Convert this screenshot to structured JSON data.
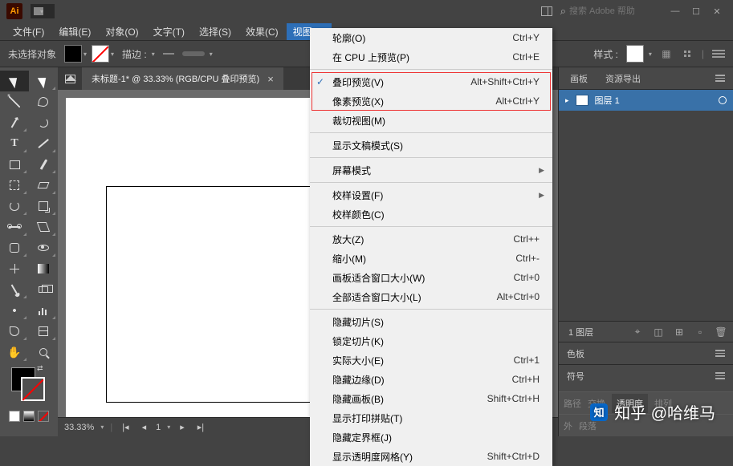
{
  "titlebar": {
    "app_badge": "Ai",
    "search_placeholder": "搜索 Adobe 帮助"
  },
  "menubar": {
    "items": [
      "文件(F)",
      "编辑(E)",
      "对象(O)",
      "文字(T)",
      "选择(S)",
      "效果(C)",
      "视图(V)"
    ],
    "active_index": 6
  },
  "options_bar": {
    "no_selection": "未选择对象",
    "stroke_label": "描边 :",
    "style_label": "样式 :"
  },
  "doc": {
    "tab_title": "未标题-1* @ 33.33% (RGB/CPU 叠印预览)",
    "zoom": "33.33%",
    "artboard_nav": "1"
  },
  "dropdown": {
    "items": [
      {
        "label": "轮廓(O)",
        "short": "Ctrl+Y"
      },
      {
        "label": "在 CPU 上预览(P)",
        "short": "Ctrl+E"
      },
      {
        "sep": true
      },
      {
        "label": "叠印预览(V)",
        "short": "Alt+Shift+Ctrl+Y",
        "checked": true,
        "hl": true
      },
      {
        "label": "像素预览(X)",
        "short": "Alt+Ctrl+Y",
        "hl": true
      },
      {
        "label": "裁切视图(M)",
        "short": ""
      },
      {
        "sep": true
      },
      {
        "label": "显示文稿模式(S)",
        "short": ""
      },
      {
        "sep": true
      },
      {
        "label": "屏幕模式",
        "short": "",
        "sub": true
      },
      {
        "sep": true
      },
      {
        "label": "校样设置(F)",
        "short": "",
        "sub": true
      },
      {
        "label": "校样颜色(C)",
        "short": ""
      },
      {
        "sep": true
      },
      {
        "label": "放大(Z)",
        "short": "Ctrl++"
      },
      {
        "label": "缩小(M)",
        "short": "Ctrl+-"
      },
      {
        "label": "画板适合窗口大小(W)",
        "short": "Ctrl+0"
      },
      {
        "label": "全部适合窗口大小(L)",
        "short": "Alt+Ctrl+0"
      },
      {
        "sep": true
      },
      {
        "label": "隐藏切片(S)",
        "short": ""
      },
      {
        "label": "锁定切片(K)",
        "short": ""
      },
      {
        "label": "实际大小(E)",
        "short": "Ctrl+1"
      },
      {
        "label": "隐藏边缘(D)",
        "short": "Ctrl+H"
      },
      {
        "label": "隐藏画板(B)",
        "short": "Shift+Ctrl+H"
      },
      {
        "label": "显示打印拼贴(T)",
        "short": ""
      },
      {
        "label": "隐藏定界框(J)",
        "short": ""
      },
      {
        "label": "显示透明度网格(Y)",
        "short": "Shift+Ctrl+D"
      }
    ]
  },
  "panels": {
    "tabs_top": [
      "画板",
      "资源导出"
    ],
    "layer_label": "图层 1",
    "layer_count": "1 图层",
    "swatch_tab": "色板",
    "symbol_tab": "符号",
    "bottom_a": [
      "路径",
      "交换",
      "透明度",
      "排列"
    ],
    "bottom_b": [
      "外",
      "段落"
    ]
  },
  "watermark": "知乎 @哈维马"
}
